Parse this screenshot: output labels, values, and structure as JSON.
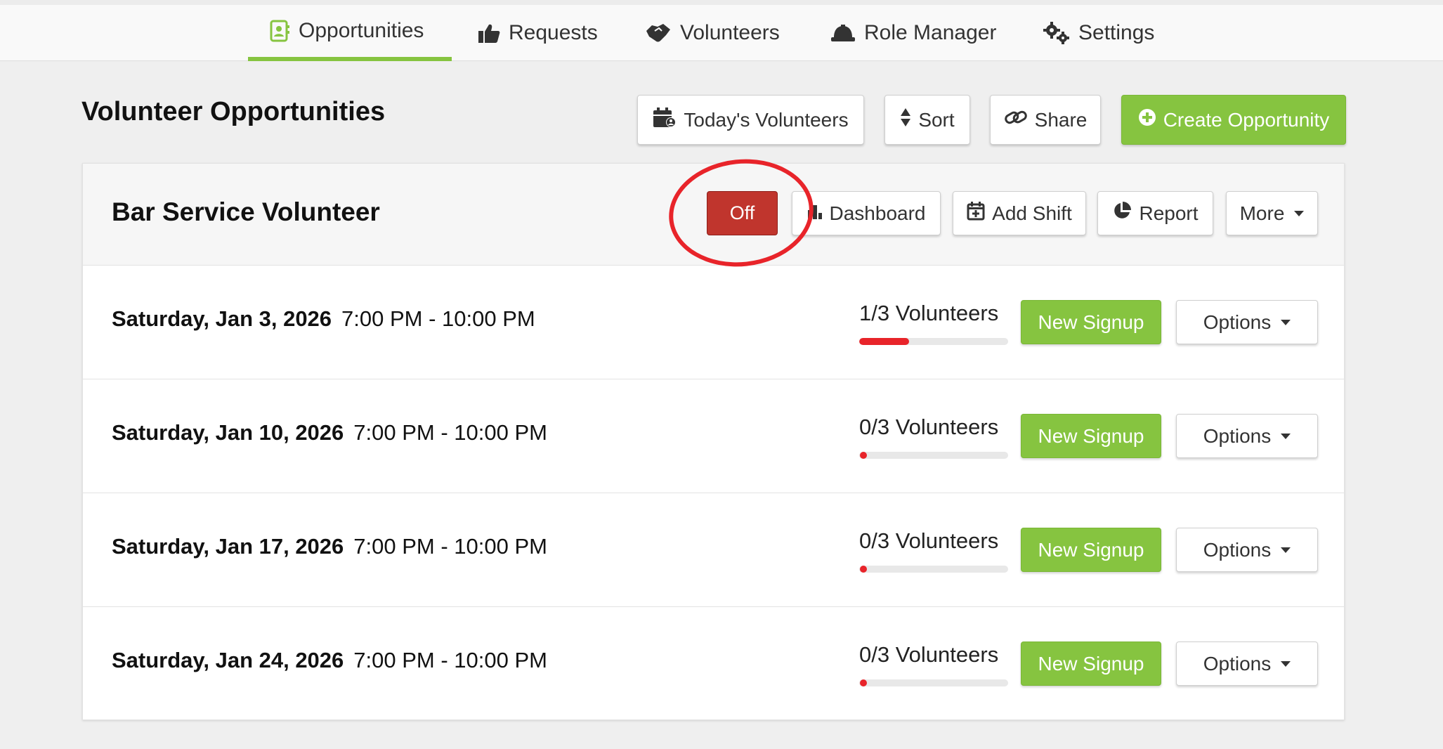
{
  "nav": {
    "tabs": [
      {
        "label": "Opportunities",
        "icon": "contact-book-icon",
        "active": true
      },
      {
        "label": "Requests",
        "icon": "thumbs-up-icon",
        "active": false
      },
      {
        "label": "Volunteers",
        "icon": "handshake-icon",
        "active": false
      },
      {
        "label": "Role Manager",
        "icon": "hard-hat-icon",
        "active": false
      },
      {
        "label": "Settings",
        "icon": "gears-icon",
        "active": false
      }
    ]
  },
  "page": {
    "title": "Volunteer Opportunities"
  },
  "toolbar": {
    "todays_volunteers_label": "Today's Volunteers",
    "sort_label": "Sort",
    "share_label": "Share",
    "create_label": "Create Opportunity"
  },
  "opportunity": {
    "title": "Bar Service Volunteer",
    "toggle_label": "Off",
    "dashboard_label": "Dashboard",
    "add_shift_label": "Add Shift",
    "report_label": "Report",
    "more_label": "More"
  },
  "shifts": [
    {
      "date": "Saturday, Jan 3, 2026",
      "time": "7:00 PM - 10:00 PM",
      "volunteers": "1/3 Volunteers",
      "filled_fraction": 0.3333,
      "signup_label": "New Signup",
      "options_label": "Options"
    },
    {
      "date": "Saturday, Jan 10, 2026",
      "time": "7:00 PM - 10:00 PM",
      "volunteers": "0/3 Volunteers",
      "filled_fraction": 0,
      "signup_label": "New Signup",
      "options_label": "Options"
    },
    {
      "date": "Saturday, Jan 17, 2026",
      "time": "7:00 PM - 10:00 PM",
      "volunteers": "0/3 Volunteers",
      "filled_fraction": 0,
      "signup_label": "New Signup",
      "options_label": "Options"
    },
    {
      "date": "Saturday, Jan 24, 2026",
      "time": "7:00 PM - 10:00 PM",
      "volunteers": "0/3 Volunteers",
      "filled_fraction": 0,
      "signup_label": "New Signup",
      "options_label": "Options"
    }
  ],
  "colors": {
    "accent_green": "#86c440",
    "danger_red": "#c0352d",
    "progress_red": "#e8242a"
  }
}
